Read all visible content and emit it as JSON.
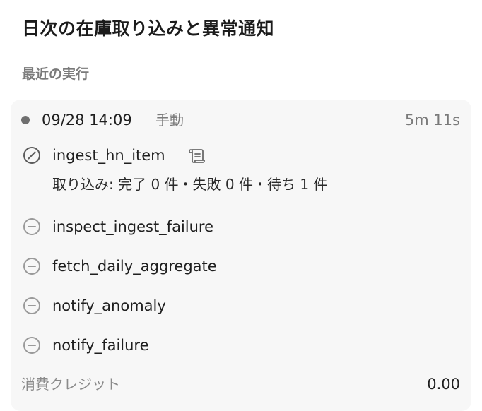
{
  "header": {
    "title": "日次の在庫取り込みと異常通知"
  },
  "section": {
    "title": "最近の実行"
  },
  "run": {
    "status_color": "#6f6f6f",
    "time": "09/28 14:09",
    "trigger": "手動",
    "duration": "5m 11s",
    "steps": [
      {
        "name": "ingest_hn_item",
        "status_icon": "skipped-circle-icon",
        "has_log_icon": true,
        "summary": "取り込み: 完了 0 件・失敗 0 件・待ち 1 件"
      },
      {
        "name": "inspect_ingest_failure",
        "status_icon": "pending-circle-icon"
      },
      {
        "name": "fetch_daily_aggregate",
        "status_icon": "pending-circle-icon"
      },
      {
        "name": "notify_anomaly",
        "status_icon": "pending-circle-icon"
      },
      {
        "name": "notify_failure",
        "status_icon": "pending-circle-icon"
      }
    ],
    "credits_label": "消費クレジット",
    "credits_value": "0.00"
  }
}
